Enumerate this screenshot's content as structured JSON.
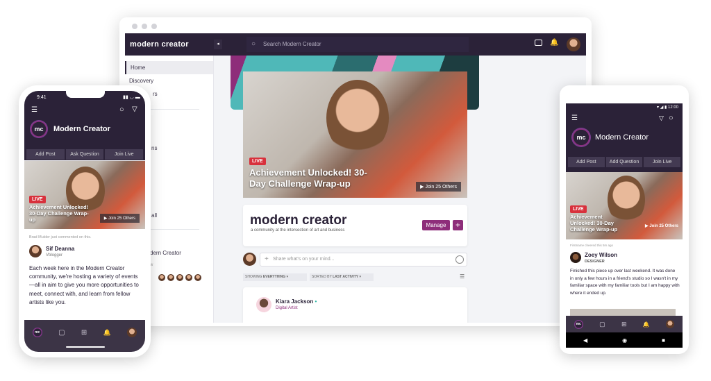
{
  "desktop": {
    "logo": "modern creator",
    "search_placeholder": "Search Modern Creator",
    "sidebar": {
      "items": [
        "Home",
        "Discovery",
        "rs",
        "ns",
        "all",
        "dern Creator",
        "w"
      ]
    },
    "video": {
      "live_badge": "LIVE",
      "title": "Achievement Unlocked! 30-Day Challenge Wrap-up",
      "join": "▶ Join 25 Others"
    },
    "community": {
      "title": "modern creator",
      "subtitle": "a community at the intersection of art and business",
      "manage": "Manage",
      "add": "+"
    },
    "composer": {
      "placeholder": "Share what's on your mind..."
    },
    "filters": {
      "showing_label": "SHOWING",
      "showing_value": "EVERYTHING",
      "sorted_label": "SORTED BY",
      "sorted_value": "LAST ACTIVITY"
    },
    "post": {
      "author": "Kiara Jackson",
      "role": "Digital Artist"
    }
  },
  "iphone": {
    "time": "9:41",
    "community": "Modern Creator",
    "logo_initials": "mc",
    "tabs": [
      "Add Post",
      "Ask Question",
      "Join Live"
    ],
    "video": {
      "live_badge": "LIVE",
      "title": "Achievement Unlocked! 30-Day Challenge Wrap-up",
      "join": "▶ Join 25 Others"
    },
    "activity": "Brad Mulder just commented on this.",
    "post": {
      "author": "Sif Deanna",
      "role": "Vblogger",
      "body": "Each week here in the Modern Creator community, we're hosting a variety of events—all in aim to give you more opportunities to meet, connect with, and learn from fellow artists like you."
    }
  },
  "android": {
    "time": "12:00",
    "community": "Modern Creator",
    "logo_initials": "mc",
    "tabs": [
      "Add Post",
      "Add Question",
      "Join Live"
    ],
    "video": {
      "live_badge": "LIVE",
      "title": "Achievement Unlocked! 30-Day Challenge Wrap-up",
      "join": "▶ Join 25 Others"
    },
    "activity": "Firstname cheered this 5m ago",
    "post": {
      "author": "Zoey Wilson",
      "role": "DESIGNER",
      "body": "Finished this piece up over last weekend. It was done in only a few hours in a friend's studio so I wasn't in my familiar space with my familiar tools but I am happy with where it ended up."
    }
  },
  "colors": {
    "header": "#2b2238",
    "accent": "#8e2d7a",
    "live": "#d8313c",
    "banner": "#4fb8b8"
  }
}
